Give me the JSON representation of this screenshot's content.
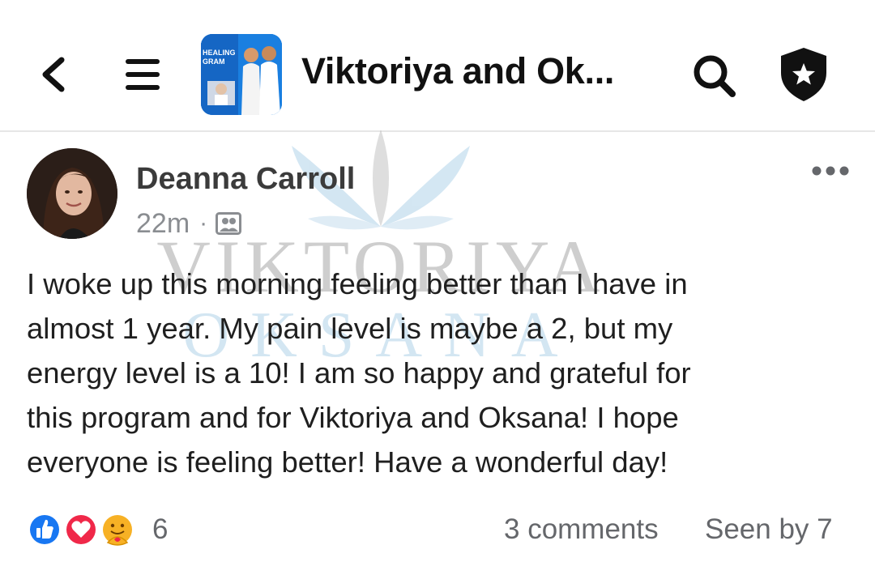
{
  "header": {
    "group_title": "Viktoriya and Ok...",
    "thumbnail_text": [
      "HEALING",
      "GRAM"
    ]
  },
  "watermark": {
    "line1": "VIKTORIYA",
    "line2": "OKSANA"
  },
  "post": {
    "author": "Deanna Carroll",
    "time": "22m",
    "separator": "·",
    "body": "I woke up this morning feeling better than I have in\nalmost 1 year. My pain level is maybe a 2, but my\nenergy level is a 10! I am so happy and grateful for\nthis program and for Viktoriya and Oksana! I hope\neveryone is feeling better! Have a wonderful day!"
  },
  "footer": {
    "reaction_count": "6",
    "comments_label": "3 comments",
    "seen_label": "Seen by 7"
  },
  "icons": [
    "back-arrow-icon",
    "menu-icon",
    "search-icon",
    "shield-star-icon",
    "members-icon",
    "more-dots-icon",
    "like-reaction-icon",
    "love-reaction-icon",
    "care-reaction-icon"
  ],
  "colors": {
    "like_blue": "#1877f2",
    "love_red": "#f02849",
    "care_yellow": "#f7b125",
    "watermark_teal": "#7ab3d9"
  }
}
